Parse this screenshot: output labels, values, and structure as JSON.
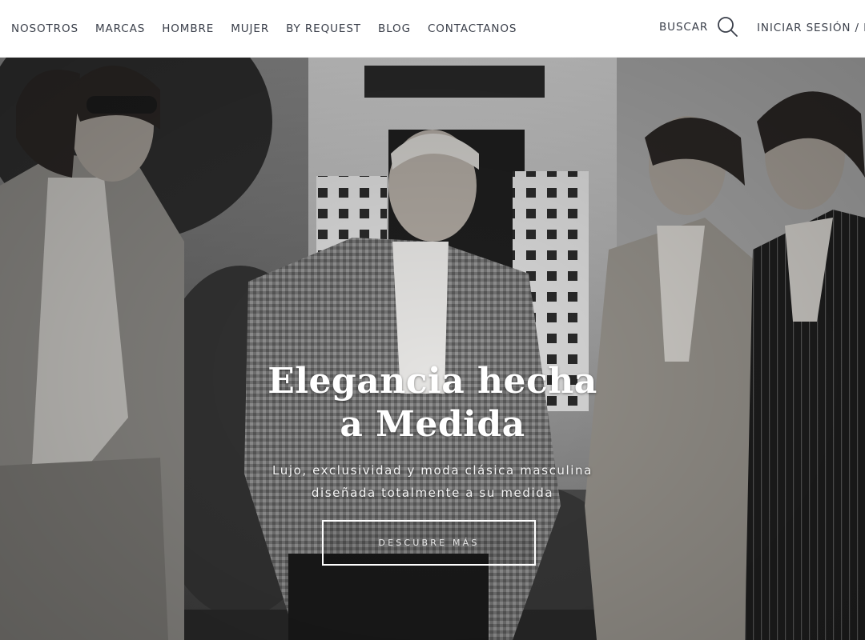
{
  "nav": {
    "items": [
      {
        "label": "NOSOTROS"
      },
      {
        "label": "MARCAS"
      },
      {
        "label": "HOMBRE"
      },
      {
        "label": "MUJER"
      },
      {
        "label": "BY REQUEST"
      },
      {
        "label": "BLOG"
      },
      {
        "label": "CONTACTANOS"
      }
    ],
    "search_label": "BUSCAR",
    "search_icon": "search-icon",
    "login_label": "INICIAR SESIÓN / RE"
  },
  "hero": {
    "title_line1": "Elegancia hecha",
    "title_line2": "a Medida",
    "subtitle_line1": "Lujo, exclusividad y moda clásica masculina",
    "subtitle_line2": "diseñada totalmente a su medida",
    "cta_label": "DESCUBRE MÁS"
  },
  "colors": {
    "nav_text": "#3a3f4a",
    "nav_bg": "#ffffff",
    "hero_text": "#ffffff"
  }
}
